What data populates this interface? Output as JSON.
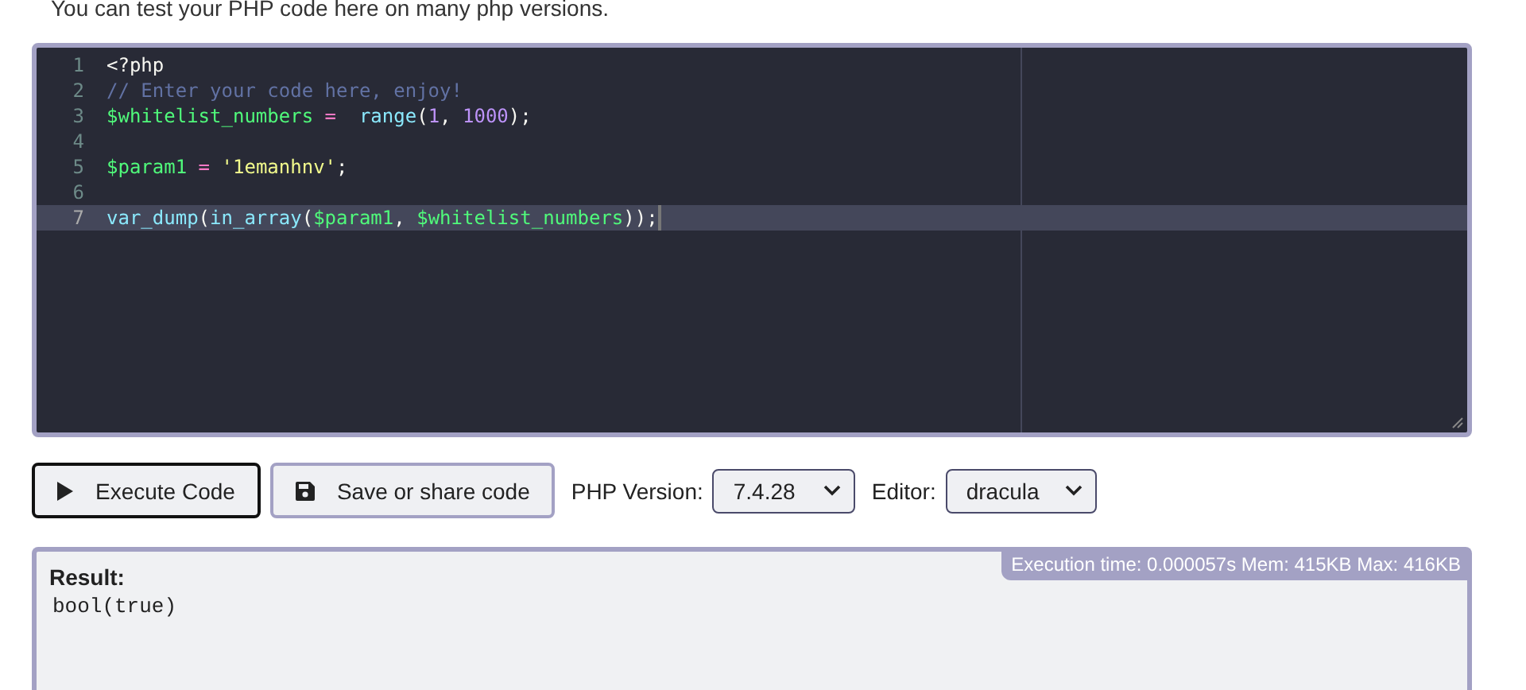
{
  "intro": "You can test your PHP code here on many php versions.",
  "editor": {
    "lines": [
      {
        "number": "1",
        "active": false,
        "tokens": [
          {
            "kind": "plain",
            "text": "<?php"
          }
        ]
      },
      {
        "number": "2",
        "active": false,
        "tokens": [
          {
            "kind": "comment",
            "text": "// Enter your code here, enjoy!"
          }
        ]
      },
      {
        "number": "3",
        "active": false,
        "tokens": [
          {
            "kind": "variable",
            "text": "$whitelist_numbers"
          },
          {
            "kind": "operator",
            "text": " =  "
          },
          {
            "kind": "function",
            "text": "range"
          },
          {
            "kind": "plain",
            "text": "("
          },
          {
            "kind": "number",
            "text": "1"
          },
          {
            "kind": "plain",
            "text": ", "
          },
          {
            "kind": "number",
            "text": "1000"
          },
          {
            "kind": "plain",
            "text": ");"
          }
        ]
      },
      {
        "number": "4",
        "active": false
      },
      {
        "number": "5",
        "active": false,
        "tokens": [
          {
            "kind": "variable",
            "text": "$param1"
          },
          {
            "kind": "operator",
            "text": " = "
          },
          {
            "kind": "string",
            "text": "'1emanhnv'"
          },
          {
            "kind": "plain",
            "text": ";"
          }
        ]
      },
      {
        "number": "6",
        "active": false
      },
      {
        "number": "7",
        "active": true,
        "tokens": [
          {
            "kind": "function",
            "text": "var_dump"
          },
          {
            "kind": "plain",
            "text": "("
          },
          {
            "kind": "function",
            "text": "in_array"
          },
          {
            "kind": "plain",
            "text": "("
          },
          {
            "kind": "variable",
            "text": "$param1"
          },
          {
            "kind": "plain",
            "text": ", "
          },
          {
            "kind": "variable",
            "text": "$whitelist_numbers"
          },
          {
            "kind": "plain",
            "text": "));"
          }
        ]
      }
    ]
  },
  "toolbar": {
    "execute": "Execute Code",
    "save": "Save or share code",
    "version_label": "PHP Version:",
    "version": "7.4.28",
    "editor_label": "Editor:",
    "theme": "dracula"
  },
  "result": {
    "label": "Result:",
    "stats": "Execution time: 0.000057s Mem: 415KB Max: 416KB",
    "output": "bool(true)"
  }
}
